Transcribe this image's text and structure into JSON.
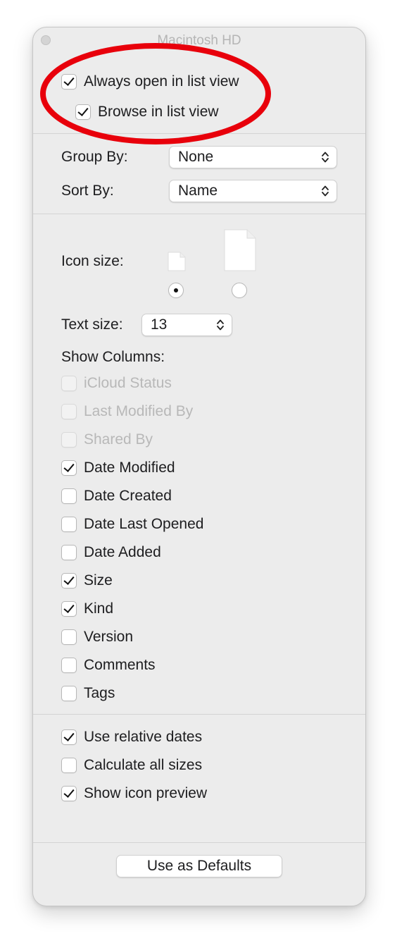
{
  "window": {
    "title": "Macintosh HD"
  },
  "top_options": [
    {
      "label": "Always open in list view",
      "checked": true
    },
    {
      "label": "Browse in list view",
      "checked": true
    }
  ],
  "group_by": {
    "label": "Group By:",
    "value": "None"
  },
  "sort_by": {
    "label": "Sort By:",
    "value": "Name"
  },
  "icon_size": {
    "label": "Icon size:",
    "selected": "small",
    "icons": [
      "small-document-icon",
      "large-document-icon"
    ]
  },
  "text_size": {
    "label": "Text size:",
    "value": "13"
  },
  "show_columns": {
    "label": "Show Columns:",
    "items": [
      {
        "label": "iCloud Status",
        "checked": false,
        "enabled": false
      },
      {
        "label": "Last Modified By",
        "checked": false,
        "enabled": false
      },
      {
        "label": "Shared By",
        "checked": false,
        "enabled": false
      },
      {
        "label": "Date Modified",
        "checked": true,
        "enabled": true
      },
      {
        "label": "Date Created",
        "checked": false,
        "enabled": true
      },
      {
        "label": "Date Last Opened",
        "checked": false,
        "enabled": true
      },
      {
        "label": "Date Added",
        "checked": false,
        "enabled": true
      },
      {
        "label": "Size",
        "checked": true,
        "enabled": true
      },
      {
        "label": "Kind",
        "checked": true,
        "enabled": true
      },
      {
        "label": "Version",
        "checked": false,
        "enabled": true
      },
      {
        "label": "Comments",
        "checked": false,
        "enabled": true
      },
      {
        "label": "Tags",
        "checked": false,
        "enabled": true
      }
    ]
  },
  "bottom_options": [
    {
      "label": "Use relative dates",
      "checked": true
    },
    {
      "label": "Calculate all sizes",
      "checked": false
    },
    {
      "label": "Show icon preview",
      "checked": true
    }
  ],
  "defaults_button": {
    "label": "Use as Defaults"
  },
  "colors": {
    "annotation": "#e8000b",
    "window_bg": "#ececec"
  }
}
